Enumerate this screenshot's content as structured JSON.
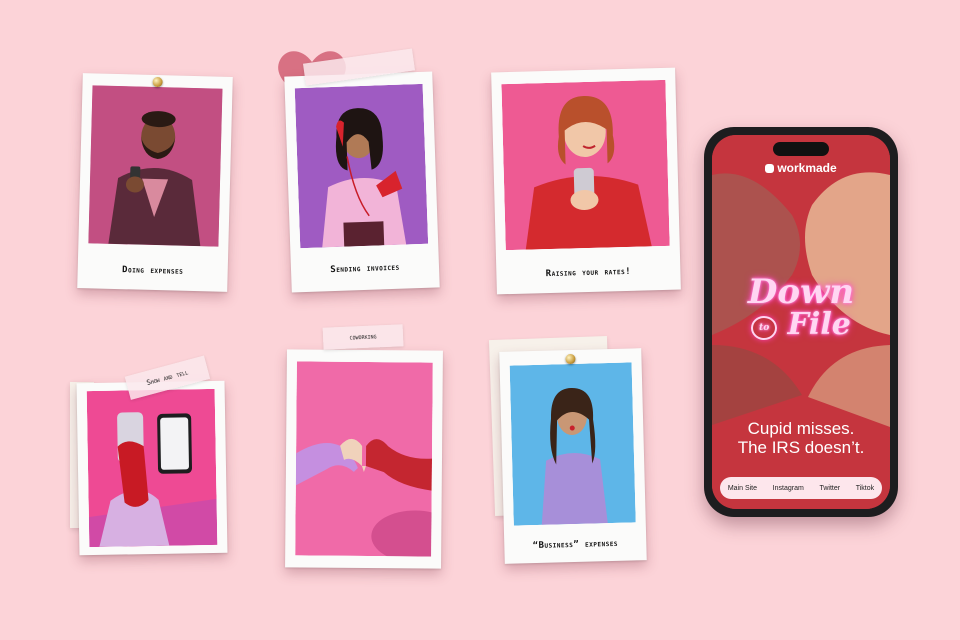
{
  "polaroids": {
    "doing_expenses": {
      "caption": "Doing expenses"
    },
    "sending_invoices": {
      "caption": "Sending invoices"
    },
    "raising_rates": {
      "caption": "Raising your rates!"
    },
    "show_and_tell": {
      "tape": "Show and tell"
    },
    "coworking": {
      "tape": "coworking"
    },
    "business_expenses": {
      "caption": "“Business” expenses"
    }
  },
  "phone": {
    "brand": "workmade",
    "headline_line1": "Down",
    "headline_small": "to",
    "headline_line2": "File",
    "tagline_line1": "Cupid misses.",
    "tagline_line2": "The IRS doesn’t.",
    "links": [
      "Main Site",
      "Instagram",
      "Twitter",
      "Tiktok"
    ]
  },
  "colors": {
    "background": "#fcd3d8",
    "phone_screen": "#c8343e",
    "neon_pink": "#ff7fd0",
    "magenta_photo": "#c2477c",
    "purple_photo": "#9d5bbf",
    "pink_photo": "#f0559a",
    "blue_photo": "#5cb2e6"
  }
}
